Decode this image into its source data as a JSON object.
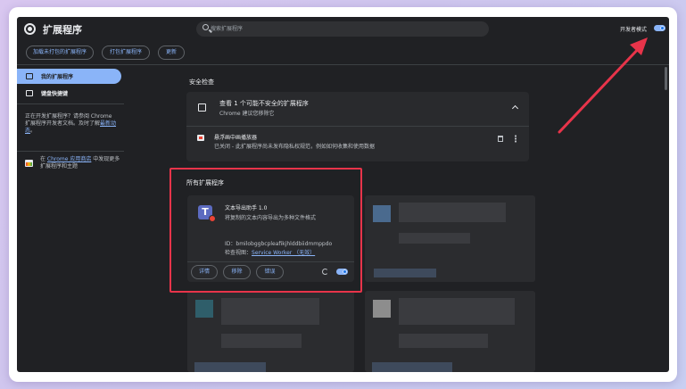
{
  "header": {
    "title": "扩展程序",
    "search_placeholder": "搜索扩展程序",
    "dev_mode_label": "开发者模式"
  },
  "toolbar": {
    "load_unpacked": "加载未打包的扩展程序",
    "pack": "打包扩展程序",
    "update": "更新"
  },
  "sidebar": {
    "items": [
      {
        "label": "我的扩展程序"
      },
      {
        "label": "键盘快捷键"
      }
    ],
    "dev_text_prefix": "正在开发扩展程序？请参阅 Chrome 扩展程序开发者文档。及时了解",
    "dev_link": "最新动态",
    "dev_text_suffix": "。",
    "store_prefix": "在 ",
    "store_link": "Chrome 应用商店",
    "store_suffix": " 中发现更多扩展程序和主题"
  },
  "safety": {
    "section_title": "安全检查",
    "card_title": "查看 1 个可能不安全的扩展程序",
    "card_subtitle": "Chrome 建议您移除它",
    "item_name": "悬浮画中画播放器",
    "item_desc": "已关闭 - 此扩展程序尚未发布隐私权规范，例如如何收集和使用数据"
  },
  "all_extensions": {
    "section_title": "所有扩展程序",
    "card": {
      "icon_letter": "T",
      "name": "文本导出助手 1.0",
      "description": "将复制的文本内容导出为多种文件格式",
      "id_text": "ID：bmilobggbcpleafikjhlddbiidmmppdo",
      "inspect_label": "检查视图：",
      "inspect_link": "Service Worker （无效）",
      "details_button": "详情",
      "remove_button": "移除",
      "errors_button": "错误"
    }
  },
  "colors": {
    "accent": "#8ab4f8",
    "background": "#202124",
    "card": "#292a2d",
    "highlight": "#e8344a"
  }
}
